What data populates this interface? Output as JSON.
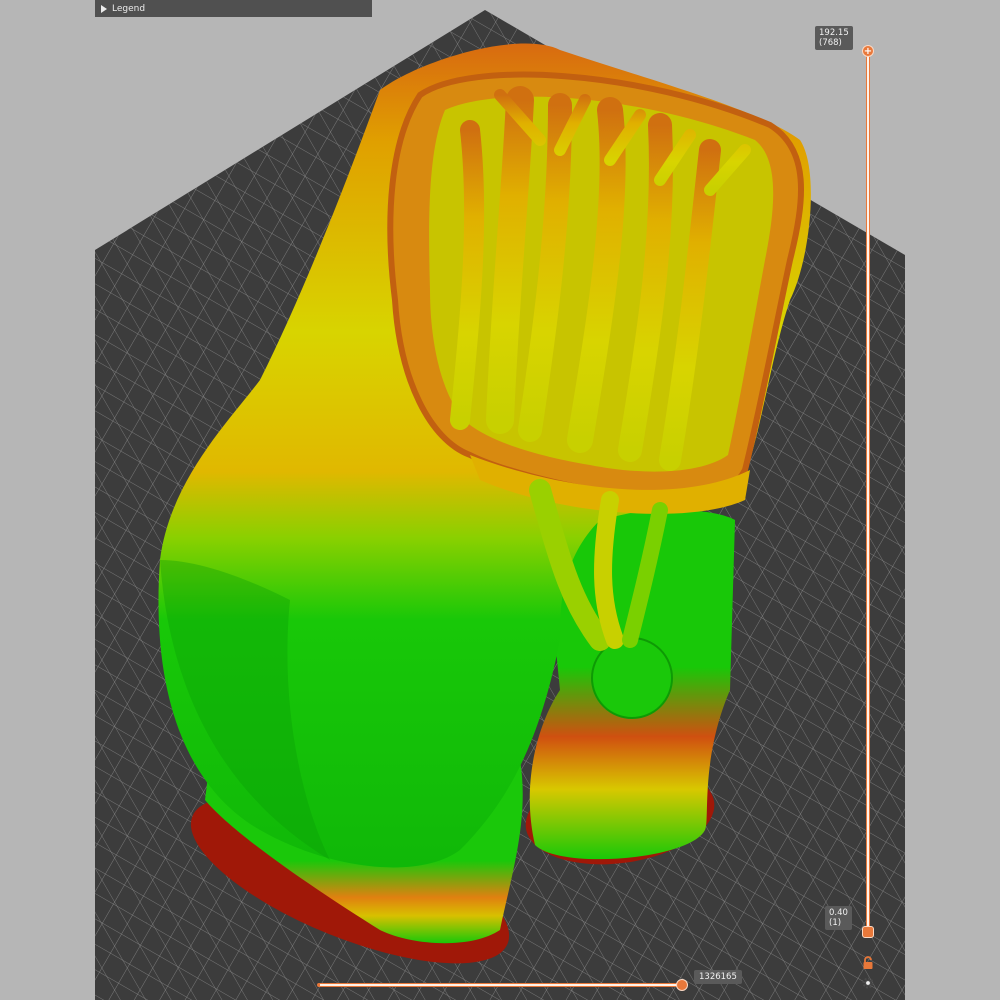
{
  "legend": {
    "label": "Legend"
  },
  "layer_slider": {
    "top_height": "192.15",
    "top_layer": "(768)",
    "bottom_height": "0.40",
    "bottom_layer": "(1)",
    "handle_top_icon": "plus-icon"
  },
  "move_slider": {
    "value": "1326165"
  },
  "icons": {
    "legend_toggle": "triangle-right-icon",
    "lock": "lock-icon",
    "settings": "cog-icon"
  },
  "colors": {
    "accent": "#e8783a",
    "background": "#b6b6b6",
    "bed": "#3c3c3c",
    "model_green": "#14c80a",
    "model_yellow": "#d8d000",
    "model_orange": "#e07818",
    "brim_red": "#a01808"
  }
}
